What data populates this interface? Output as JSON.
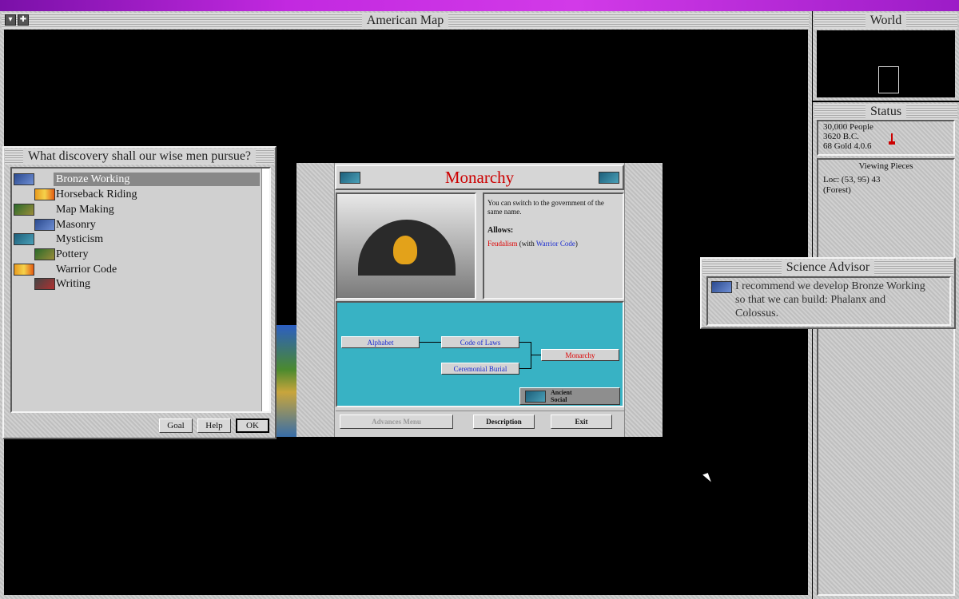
{
  "top_strip_color": "#b01fd6",
  "main_map": {
    "title": "American Map"
  },
  "world_panel": {
    "title": "World"
  },
  "status_panel": {
    "title": "Status",
    "people": "30,000 People",
    "year": "3620 B.C.",
    "gold": "68 Gold  4.0.6",
    "viewing_title": "Viewing Pieces",
    "loc": "Loc: (53, 95) 43",
    "terrain": "(Forest)"
  },
  "research_dialog": {
    "title": "What discovery shall our wise men pursue?",
    "items": [
      {
        "label": "Bronze Working",
        "icon": "bronze-working-icon",
        "selected": true
      },
      {
        "label": "Horseback Riding",
        "icon": "horseback-riding-icon"
      },
      {
        "label": "Map Making",
        "icon": "map-making-icon"
      },
      {
        "label": "Masonry",
        "icon": "masonry-icon"
      },
      {
        "label": "Mysticism",
        "icon": "mysticism-icon"
      },
      {
        "label": "Pottery",
        "icon": "pottery-icon"
      },
      {
        "label": "Warrior Code",
        "icon": "warrior-code-icon"
      },
      {
        "label": "Writing",
        "icon": "writing-icon"
      }
    ],
    "buttons": {
      "goal": "Goal",
      "help": "Help",
      "ok": "OK"
    }
  },
  "civilopedia": {
    "title": "Monarchy",
    "description": "You can switch to the government of the same name.",
    "allows_label": "Allows:",
    "allows_item": "Feudalism",
    "allows_with": "(with",
    "allows_req": "Warrior Code",
    "allows_close": ")",
    "tree": {
      "alphabet": "Alphabet",
      "code_of_laws": "Code of Laws",
      "ceremonial_burial": "Ceremonial Burial",
      "monarchy": "Monarchy"
    },
    "era": "Ancient",
    "category": "Social",
    "buttons": {
      "advances_menu": "Advances Menu",
      "description": "Description",
      "exit": "Exit"
    }
  },
  "science_advisor": {
    "title": "Science Advisor",
    "message": "I recommend we develop Bronze Working so that we can build: Phalanx and Colossus."
  }
}
